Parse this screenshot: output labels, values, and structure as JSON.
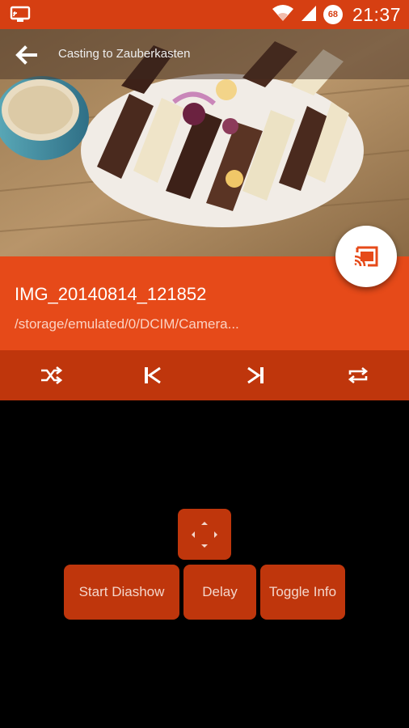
{
  "status_bar": {
    "time": "21:37",
    "battery_level": "68",
    "icons": [
      "cast-screen-icon",
      "wifi-icon",
      "signal-icon",
      "battery-icon"
    ]
  },
  "app_bar": {
    "title": "Casting to Zauberkasten",
    "back_icon": "arrow-left-icon"
  },
  "media": {
    "file_name": "IMG_20140814_121852",
    "file_path": "/storage/emulated/0/DCIM/Camera..."
  },
  "controls": {
    "items": [
      "shuffle-icon",
      "skip-previous-icon",
      "skip-next-icon",
      "repeat-icon"
    ]
  },
  "remote": {
    "dpad_icon": "directional-pad-icon",
    "start_label": "Start Diashow",
    "delay_label": "Delay",
    "toggle_label": "Toggle Info"
  },
  "colors": {
    "status_bar": "#d63f12",
    "primary": "#e64a19",
    "primary_dark": "#bf360c",
    "background": "#000000"
  }
}
